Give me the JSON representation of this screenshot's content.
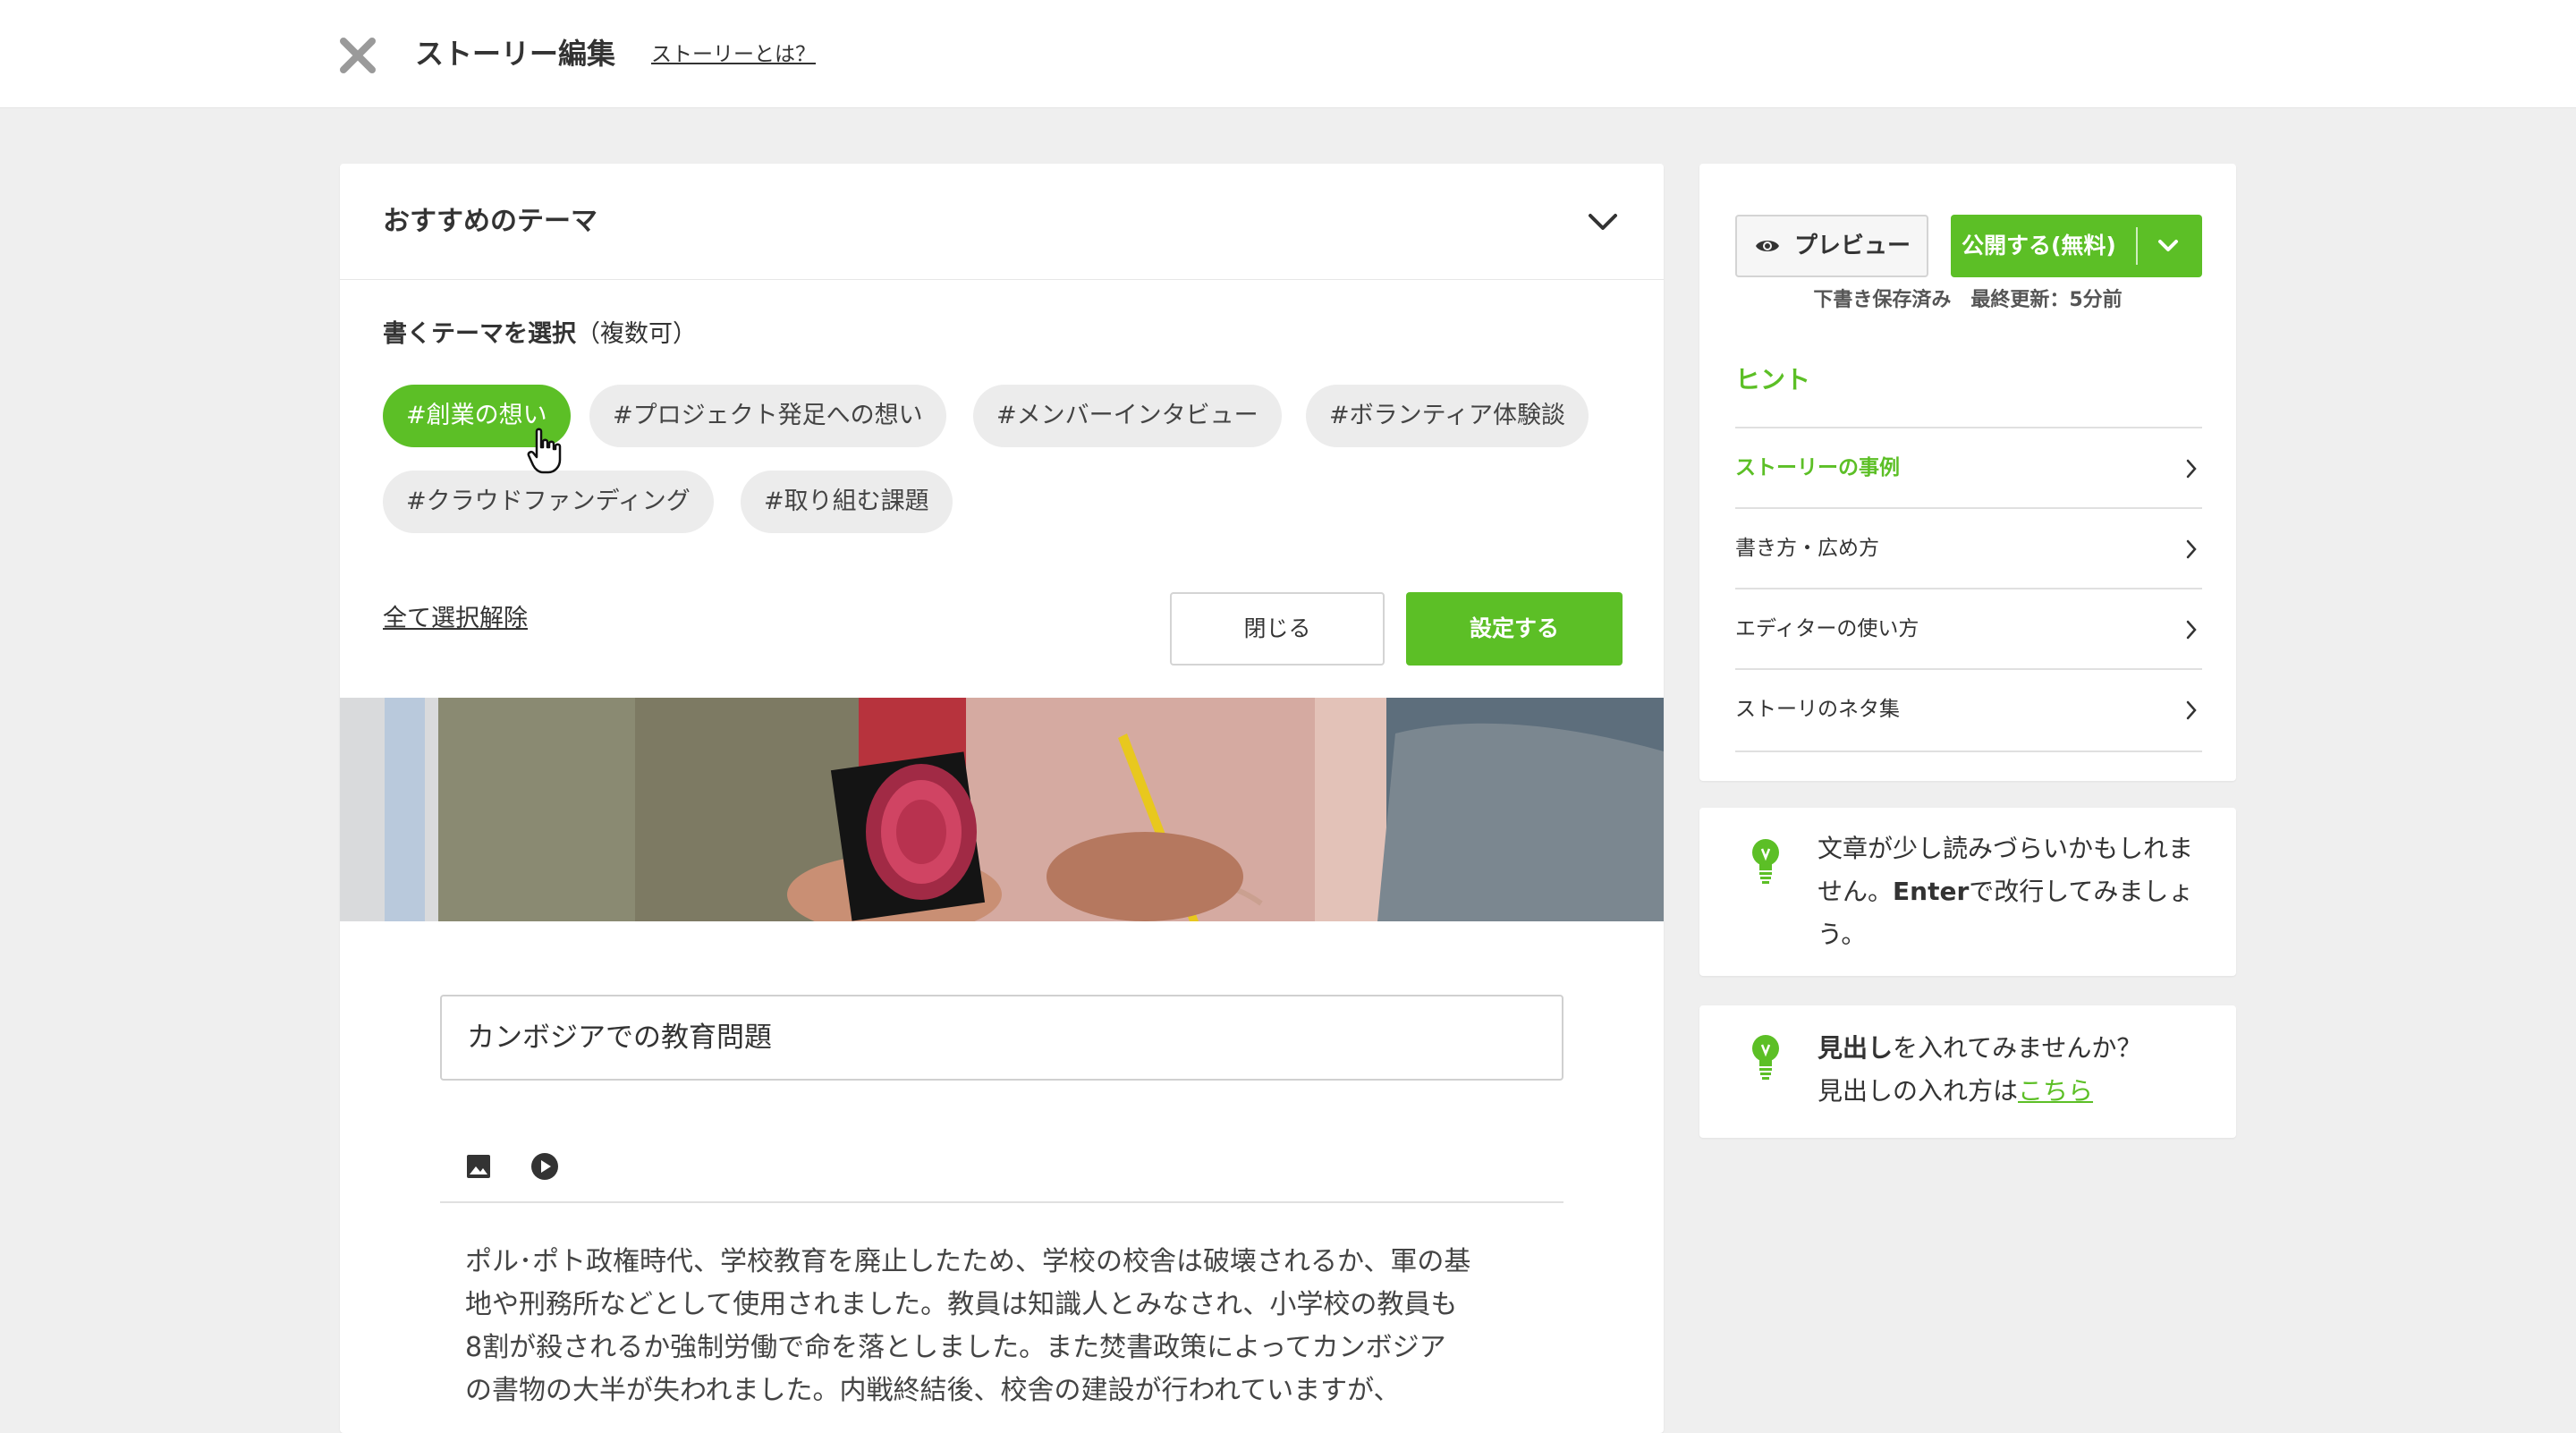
{
  "header": {
    "title": "ストーリー編集",
    "help_link": "ストーリーとは？"
  },
  "themes": {
    "section_title": "おすすめのテーマ",
    "select_label_bold": "書くテーマを選択",
    "select_label_note": "（複数可）",
    "tags": [
      {
        "label": "#創業の想い",
        "selected": true
      },
      {
        "label": "#プロジェクト発足への想い",
        "selected": false
      },
      {
        "label": "#メンバーインタビュー",
        "selected": false
      },
      {
        "label": "#ボランティア体験談",
        "selected": false
      },
      {
        "label": "#クラウドファンディング",
        "selected": false
      },
      {
        "label": "#取り組む課題",
        "selected": false
      }
    ],
    "clear_all": "全て選択解除",
    "close_label": "閉じる",
    "apply_label": "設定する"
  },
  "editor": {
    "title_value": "カンボジアでの教育問題",
    "body_lines": [
      "ポル･ポト政権時代、学校教育を廃止したため、学校の校舎は破壊されるか、軍の基",
      "地や刑務所などとして使用されました。教員は知識人とみなされ、小学校の教員も",
      "8割が殺されるか強制労働で命を落としました。また焚書政策によってカンボジア",
      "の書物の大半が失われました。内戦終結後、校舎の建設が行われていますが、"
    ]
  },
  "sidebar": {
    "preview_label": "プレビュー",
    "publish_label": "公開する(無料)",
    "save_status": "下書き保存済み　最終更新：5分前",
    "hint_title": "ヒント",
    "hint_items": [
      {
        "label": "ストーリーの事例",
        "active": true
      },
      {
        "label": "書き方・広め方",
        "active": false
      },
      {
        "label": "エディターの使い方",
        "active": false
      },
      {
        "label": "ストーリのネタ集",
        "active": false
      }
    ]
  },
  "tips": {
    "readability": {
      "pre": "文章が少し読みづらいかもしれま",
      "line2_pre": "せん。",
      "line2_bold": "Enter",
      "line2_post": "で改行してみましょ",
      "line3": "う。"
    },
    "heading": {
      "bold": "見出し",
      "post": "を入れてみませんか？",
      "line2": "見出しの入れ方は",
      "link": "こちら"
    }
  },
  "colors": {
    "accent": "#5cbf26",
    "background": "#efefef"
  },
  "icons": [
    "close-icon",
    "chevron-down-icon",
    "hand-cursor-icon",
    "image-icon",
    "video-icon",
    "eye-icon",
    "chevron-right-icon",
    "lightbulb-icon"
  ]
}
